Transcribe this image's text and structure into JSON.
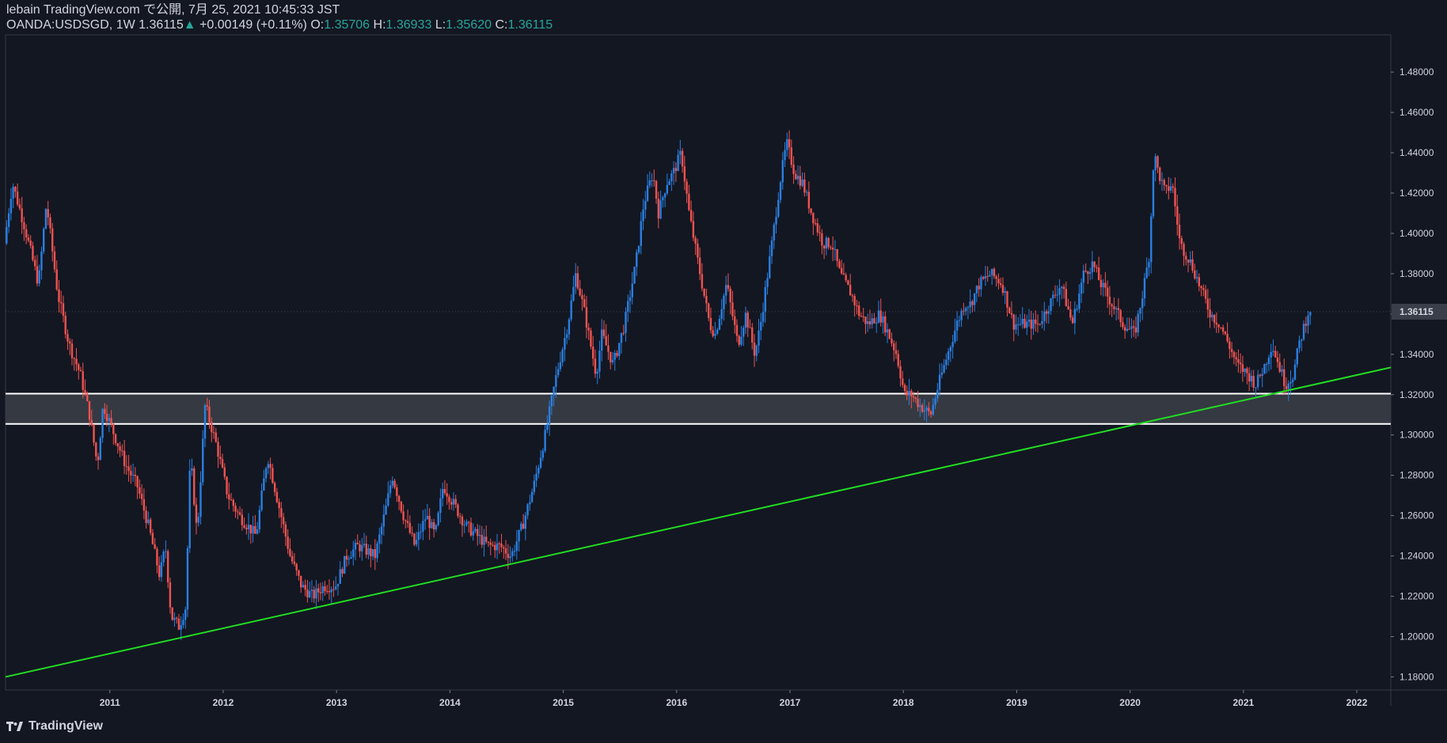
{
  "header": {
    "publisher_line": "lebain TradingView.com で公開, 7月 25, 2021 10:45:33 JST",
    "symbol": "OANDA:USDSGD, 1W 1.36115",
    "change_arrow": "▲",
    "change": "+0.00149 (+0.11%)",
    "o_label": "O:",
    "o_value": "1.35706",
    "h_label": "H:",
    "h_value": "1.36933",
    "l_label": "L:",
    "l_value": "1.35620",
    "c_label": "C:",
    "c_value": "1.36115"
  },
  "footer": {
    "brand": "TradingView",
    "logo_icon": "tradingview-logo-icon"
  },
  "colors": {
    "background": "#131722",
    "up": "#2a7fe0",
    "down": "#ef5350",
    "trendline": "#22dd22",
    "zone_fill": "#3a3d46",
    "zone_border": "#ffffff",
    "last_price_label": "#3a3e4a"
  },
  "chart_data": {
    "type": "candlestick",
    "timeframe": "1W",
    "x_tick_labels": [
      "2011",
      "2012",
      "2013",
      "2014",
      "2015",
      "2016",
      "2017",
      "2018",
      "2019",
      "2020",
      "2021",
      "2022"
    ],
    "y_tick_labels": [
      "1.48000",
      "1.46000",
      "1.44000",
      "1.42000",
      "1.40000",
      "1.38000",
      "1.36000",
      "1.34000",
      "1.32000",
      "1.30000",
      "1.28000",
      "1.26000",
      "1.24000",
      "1.22000",
      "1.20000",
      "1.18000"
    ],
    "xlim": [
      2010.08,
      2022.3
    ],
    "ylim": [
      1.1735,
      1.4985
    ],
    "last_price": "1.36115",
    "price_path": [
      [
        2010.08,
        1.395
      ],
      [
        2010.15,
        1.425
      ],
      [
        2010.25,
        1.405
      ],
      [
        2010.38,
        1.375
      ],
      [
        2010.45,
        1.415
      ],
      [
        2010.55,
        1.37
      ],
      [
        2010.65,
        1.345
      ],
      [
        2010.75,
        1.33
      ],
      [
        2010.83,
        1.31
      ],
      [
        2010.9,
        1.285
      ],
      [
        2010.95,
        1.315
      ],
      [
        2011.05,
        1.3
      ],
      [
        2011.15,
        1.285
      ],
      [
        2011.25,
        1.275
      ],
      [
        2011.35,
        1.255
      ],
      [
        2011.45,
        1.23
      ],
      [
        2011.5,
        1.245
      ],
      [
        2011.55,
        1.21
      ],
      [
        2011.62,
        1.205
      ],
      [
        2011.68,
        1.215
      ],
      [
        2011.72,
        1.29
      ],
      [
        2011.78,
        1.25
      ],
      [
        2011.85,
        1.315
      ],
      [
        2011.95,
        1.295
      ],
      [
        2012.05,
        1.27
      ],
      [
        2012.15,
        1.26
      ],
      [
        2012.3,
        1.25
      ],
      [
        2012.4,
        1.29
      ],
      [
        2012.5,
        1.265
      ],
      [
        2012.6,
        1.24
      ],
      [
        2012.7,
        1.225
      ],
      [
        2012.8,
        1.22
      ],
      [
        2012.9,
        1.225
      ],
      [
        2013.0,
        1.225
      ],
      [
        2013.1,
        1.24
      ],
      [
        2013.2,
        1.245
      ],
      [
        2013.35,
        1.24
      ],
      [
        2013.45,
        1.265
      ],
      [
        2013.5,
        1.28
      ],
      [
        2013.6,
        1.26
      ],
      [
        2013.7,
        1.245
      ],
      [
        2013.8,
        1.26
      ],
      [
        2013.88,
        1.25
      ],
      [
        2013.95,
        1.275
      ],
      [
        2014.05,
        1.265
      ],
      [
        2014.15,
        1.255
      ],
      [
        2014.25,
        1.25
      ],
      [
        2014.35,
        1.245
      ],
      [
        2014.45,
        1.245
      ],
      [
        2014.55,
        1.24
      ],
      [
        2014.65,
        1.255
      ],
      [
        2014.75,
        1.275
      ],
      [
        2014.85,
        1.3
      ],
      [
        2014.95,
        1.33
      ],
      [
        2015.05,
        1.355
      ],
      [
        2015.12,
        1.38
      ],
      [
        2015.2,
        1.36
      ],
      [
        2015.3,
        1.33
      ],
      [
        2015.35,
        1.35
      ],
      [
        2015.45,
        1.335
      ],
      [
        2015.55,
        1.355
      ],
      [
        2015.65,
        1.385
      ],
      [
        2015.72,
        1.415
      ],
      [
        2015.8,
        1.43
      ],
      [
        2015.85,
        1.41
      ],
      [
        2015.92,
        1.425
      ],
      [
        2015.98,
        1.43
      ],
      [
        2016.05,
        1.44
      ],
      [
        2016.12,
        1.41
      ],
      [
        2016.2,
        1.385
      ],
      [
        2016.3,
        1.355
      ],
      [
        2016.35,
        1.35
      ],
      [
        2016.45,
        1.375
      ],
      [
        2016.55,
        1.345
      ],
      [
        2016.62,
        1.36
      ],
      [
        2016.7,
        1.34
      ],
      [
        2016.75,
        1.355
      ],
      [
        2016.85,
        1.395
      ],
      [
        2016.92,
        1.425
      ],
      [
        2016.98,
        1.445
      ],
      [
        2017.05,
        1.43
      ],
      [
        2017.12,
        1.425
      ],
      [
        2017.2,
        1.41
      ],
      [
        2017.3,
        1.395
      ],
      [
        2017.38,
        1.395
      ],
      [
        2017.45,
        1.38
      ],
      [
        2017.55,
        1.37
      ],
      [
        2017.62,
        1.36
      ],
      [
        2017.7,
        1.355
      ],
      [
        2017.8,
        1.36
      ],
      [
        2017.88,
        1.35
      ],
      [
        2017.95,
        1.34
      ],
      [
        2018.02,
        1.32
      ],
      [
        2018.08,
        1.32
      ],
      [
        2018.15,
        1.315
      ],
      [
        2018.25,
        1.31
      ],
      [
        2018.32,
        1.325
      ],
      [
        2018.4,
        1.34
      ],
      [
        2018.48,
        1.355
      ],
      [
        2018.55,
        1.365
      ],
      [
        2018.6,
        1.365
      ],
      [
        2018.68,
        1.375
      ],
      [
        2018.78,
        1.38
      ],
      [
        2018.88,
        1.375
      ],
      [
        2018.98,
        1.355
      ],
      [
        2019.08,
        1.355
      ],
      [
        2019.2,
        1.355
      ],
      [
        2019.3,
        1.365
      ],
      [
        2019.4,
        1.375
      ],
      [
        2019.5,
        1.355
      ],
      [
        2019.6,
        1.38
      ],
      [
        2019.68,
        1.385
      ],
      [
        2019.75,
        1.375
      ],
      [
        2019.85,
        1.365
      ],
      [
        2019.95,
        1.355
      ],
      [
        2020.05,
        1.35
      ],
      [
        2020.12,
        1.37
      ],
      [
        2020.18,
        1.39
      ],
      [
        2020.22,
        1.44
      ],
      [
        2020.26,
        1.43
      ],
      [
        2020.32,
        1.42
      ],
      [
        2020.38,
        1.425
      ],
      [
        2020.45,
        1.395
      ],
      [
        2020.55,
        1.385
      ],
      [
        2020.65,
        1.37
      ],
      [
        2020.72,
        1.36
      ],
      [
        2020.8,
        1.355
      ],
      [
        2020.88,
        1.345
      ],
      [
        2020.95,
        1.335
      ],
      [
        2021.05,
        1.33
      ],
      [
        2021.12,
        1.325
      ],
      [
        2021.2,
        1.335
      ],
      [
        2021.26,
        1.345
      ],
      [
        2021.32,
        1.335
      ],
      [
        2021.38,
        1.325
      ],
      [
        2021.45,
        1.33
      ],
      [
        2021.5,
        1.345
      ],
      [
        2021.55,
        1.355
      ],
      [
        2021.58,
        1.361
      ]
    ],
    "annotations": {
      "support_zone": {
        "low": 1.3055,
        "high": 1.3205
      },
      "trendline": {
        "start": [
          2010.08,
          1.18
        ],
        "end": [
          2022.3,
          1.3335
        ]
      }
    }
  }
}
